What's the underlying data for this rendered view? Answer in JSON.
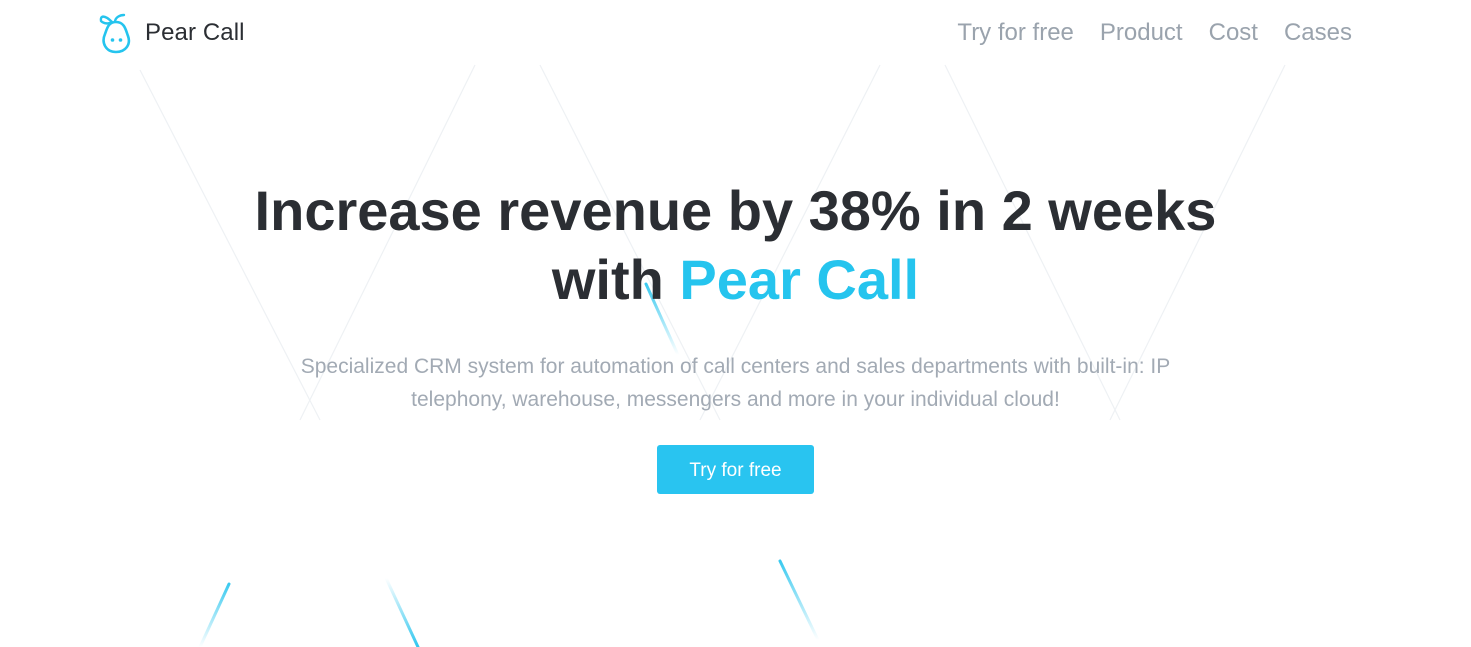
{
  "header": {
    "brand_name": "Pear Call",
    "logo_icon": "pear-logo-icon",
    "nav": [
      {
        "label": "Try for free"
      },
      {
        "label": "Product"
      },
      {
        "label": "Cost"
      },
      {
        "label": "Cases"
      }
    ]
  },
  "hero": {
    "headline_line1": "Increase revenue by 38% in 2 weeks",
    "headline_line2_prefix": "with",
    "headline_brand": "Pear Call",
    "subtitle": "Specialized CRM system for automation of call centers and sales departments with built-in: IP telephony, warehouse, messengers and more in your individual cloud!",
    "cta_label": "Try for free"
  },
  "colors": {
    "accent": "#25c4ee",
    "button": "#29c4f0",
    "heading": "#2b2e33",
    "nav_text": "#9aa3ad",
    "subtitle_text": "#a2aab4",
    "background": "#ffffff"
  }
}
